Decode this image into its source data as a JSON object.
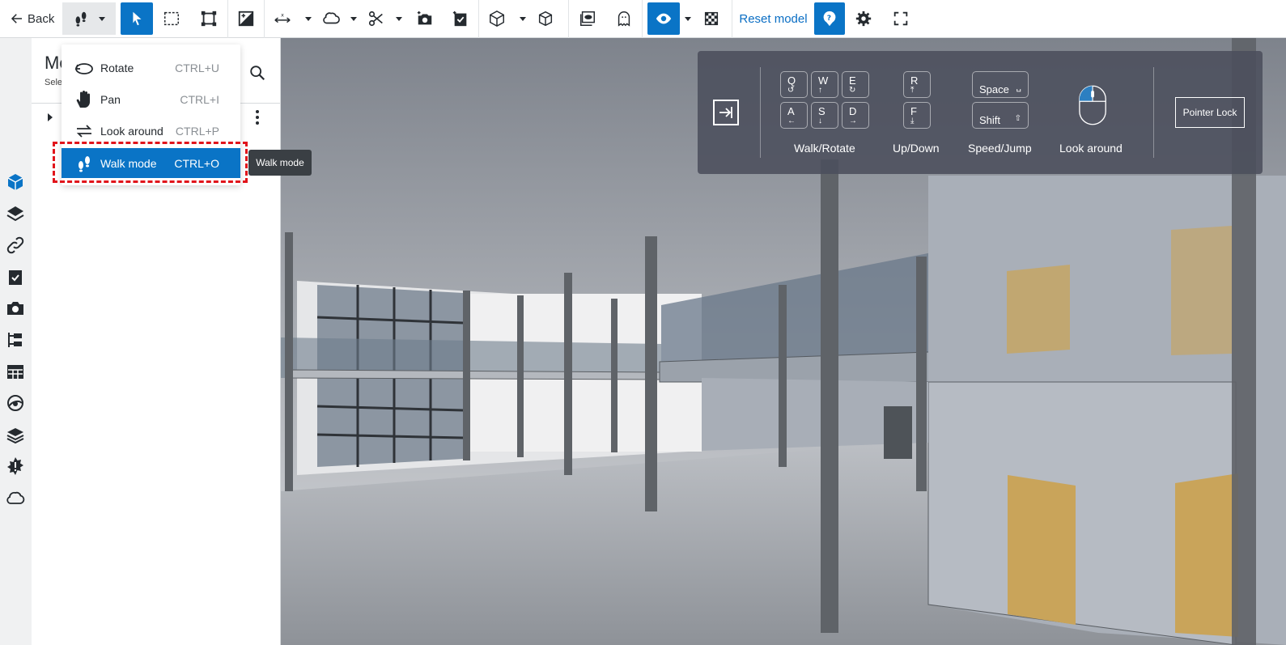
{
  "toolbar": {
    "back_label": "Back",
    "reset_label": "Reset model"
  },
  "panel": {
    "title": "Mo",
    "subtitle": "Sele"
  },
  "nav_menu": {
    "items": [
      {
        "label": "Rotate",
        "shortcut": "CTRL+U",
        "icon": "rotate-icon"
      },
      {
        "label": "Pan",
        "shortcut": "CTRL+I",
        "icon": "hand-icon"
      },
      {
        "label": "Look around",
        "shortcut": "CTRL+P",
        "icon": "look-around-icon"
      },
      {
        "label": "Walk mode",
        "shortcut": "CTRL+O",
        "icon": "footsteps-icon",
        "selected": true
      }
    ]
  },
  "tooltip": "Walk mode",
  "controls": {
    "keys": {
      "q": "Q",
      "w": "W",
      "e": "E",
      "a": "A",
      "s": "S",
      "d": "D",
      "r": "R",
      "f": "F",
      "space": "Space",
      "shift": "Shift"
    },
    "labels": {
      "walk_rotate": "Walk/Rotate",
      "up_down": "Up/Down",
      "speed_jump": "Speed/Jump",
      "look_around": "Look around"
    },
    "pointer_lock": "Pointer Lock"
  },
  "colors": {
    "accent": "#0a74c6",
    "highlight": "#e1141b",
    "door": "#c9a45a"
  }
}
